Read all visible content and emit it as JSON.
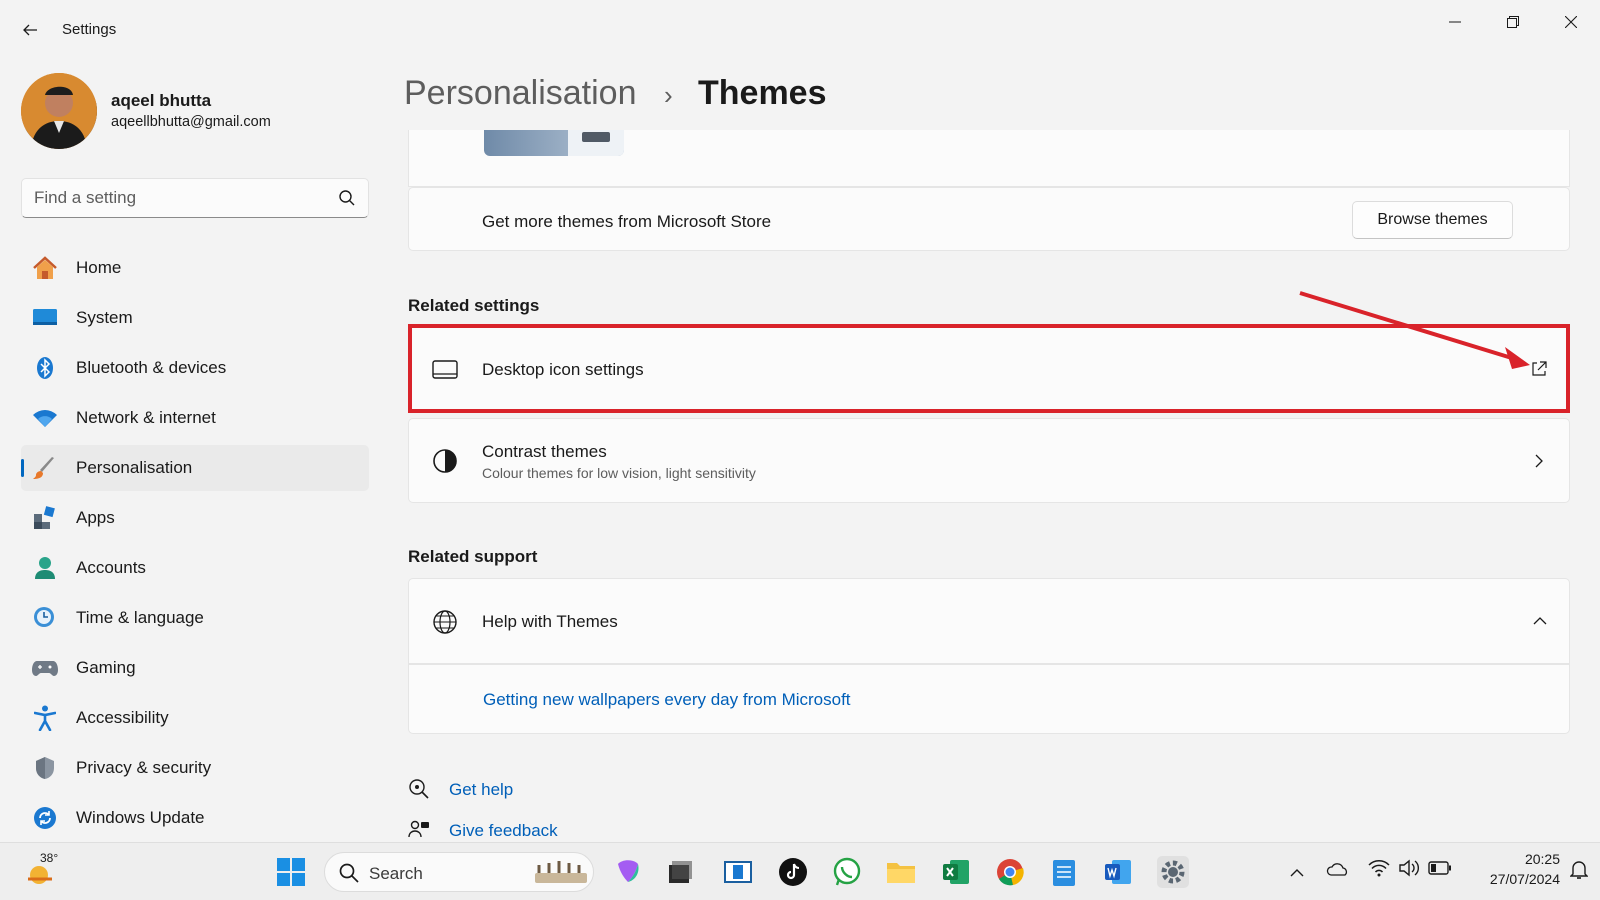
{
  "window": {
    "app_title": "Settings",
    "controls": [
      "minimize",
      "restore",
      "close"
    ]
  },
  "profile": {
    "name": "aqeel bhutta",
    "email": "aqeellbhutta@gmail.com"
  },
  "search": {
    "placeholder": "Find a setting"
  },
  "nav": {
    "items": [
      {
        "label": "Home",
        "icon": "home-icon"
      },
      {
        "label": "System",
        "icon": "system-icon"
      },
      {
        "label": "Bluetooth & devices",
        "icon": "bluetooth-icon"
      },
      {
        "label": "Network & internet",
        "icon": "wifi-icon"
      },
      {
        "label": "Personalisation",
        "icon": "brush-icon",
        "active": true
      },
      {
        "label": "Apps",
        "icon": "apps-icon"
      },
      {
        "label": "Accounts",
        "icon": "account-icon"
      },
      {
        "label": "Time & language",
        "icon": "globe-clock-icon"
      },
      {
        "label": "Gaming",
        "icon": "gamepad-icon"
      },
      {
        "label": "Accessibility",
        "icon": "accessibility-icon"
      },
      {
        "label": "Privacy & security",
        "icon": "shield-icon"
      },
      {
        "label": "Windows Update",
        "icon": "update-icon"
      }
    ]
  },
  "breadcrumb": {
    "parent": "Personalisation",
    "separator": "›",
    "current": "Themes"
  },
  "content": {
    "store_row": {
      "text": "Get more themes from Microsoft Store",
      "button": "Browse themes"
    },
    "related_settings": {
      "title": "Related settings",
      "desktop_icon": {
        "label": "Desktop icon settings"
      },
      "contrast": {
        "label": "Contrast themes",
        "sub": "Colour themes for low vision, light sensitivity"
      }
    },
    "related_support": {
      "title": "Related support",
      "help": {
        "label": "Help with Themes"
      },
      "link": "Getting new wallpapers every day from Microsoft"
    },
    "footer_links": {
      "get_help": "Get help",
      "give_feedback": "Give feedback"
    }
  },
  "annotation": {
    "color": "#d9232a"
  },
  "taskbar": {
    "weather_temp": "38°",
    "search_label": "Search",
    "time": "20:25",
    "date": "27/07/2024"
  },
  "colors": {
    "accent": "#0067c0",
    "link": "#005fb8",
    "highlight": "#d9232a"
  }
}
